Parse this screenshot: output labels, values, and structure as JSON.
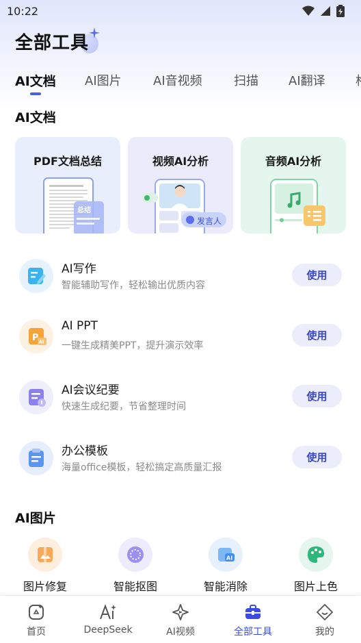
{
  "status_bar": {
    "time": "10:22"
  },
  "page": {
    "title": "全部工具"
  },
  "tabs": [
    {
      "label": "AI文档"
    },
    {
      "label": "AI图片"
    },
    {
      "label": "AI音视频"
    },
    {
      "label": "扫描"
    },
    {
      "label": "AI翻译"
    },
    {
      "label": "格"
    }
  ],
  "sections": {
    "docs": {
      "title": "AI文档"
    },
    "images": {
      "title": "AI图片"
    }
  },
  "feature_cards": [
    {
      "title": "PDF文档总结",
      "badge": "总结"
    },
    {
      "title": "视频AI分析",
      "badge": "发言人"
    },
    {
      "title": "音频AI分析"
    }
  ],
  "tools": [
    {
      "name": "AI写作",
      "desc": "智能辅助写作，轻松输出优质内容",
      "button": "使用"
    },
    {
      "name": "AI PPT",
      "desc": "一键生成精美PPT，提升演示效率",
      "button": "使用"
    },
    {
      "name": "AI会议纪要",
      "desc": "快速生成纪要，节省整理时间",
      "button": "使用"
    },
    {
      "name": "办公模板",
      "desc": "海量office模板，轻松搞定高质量汇报",
      "button": "使用"
    }
  ],
  "image_tools": [
    {
      "label": "图片修复"
    },
    {
      "label": "智能抠图"
    },
    {
      "label": "智能消除"
    },
    {
      "label": "图片上色"
    }
  ],
  "bottom_nav": [
    {
      "label": "首页"
    },
    {
      "label": "DeepSeek"
    },
    {
      "label": "AI视频"
    },
    {
      "label": "全部工具"
    },
    {
      "label": "我的"
    }
  ],
  "colors": {
    "accent": "#3a4de0",
    "button_bg": "#ecedfb",
    "button_text": "#3948c9",
    "card_pdf": "#e9eefc",
    "card_video": "#ecebfc",
    "card_audio": "#e5f6ee"
  }
}
